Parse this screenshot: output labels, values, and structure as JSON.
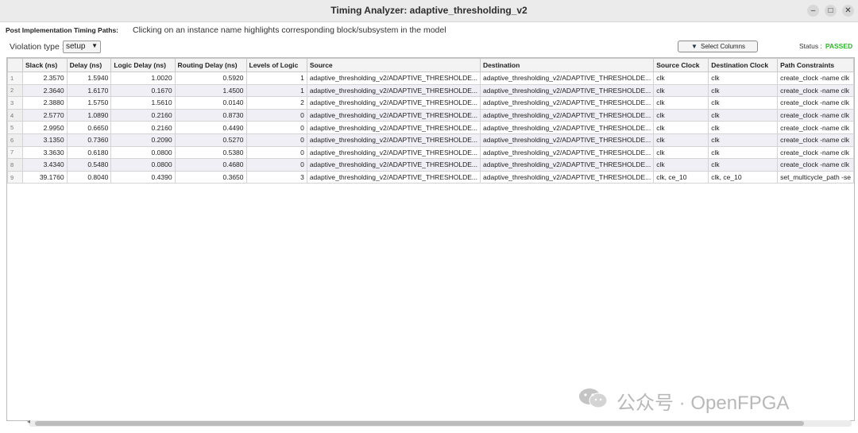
{
  "window": {
    "title": "Timing Analyzer: adaptive_thresholding_v2",
    "minimize": "–",
    "maximize": "□",
    "close": "✕"
  },
  "info": {
    "label": "Post Implementation Timing Paths:",
    "message": "Clicking on an instance name highlights corresponding block/subsystem in the model"
  },
  "toolbar": {
    "violation_label": "Violation type :",
    "violation_value": "setup",
    "select_columns": "Select Columns",
    "status_label": "Status :",
    "status_value": "PASSED",
    "status_color": "#2db52d"
  },
  "table": {
    "headers": [
      "",
      "Slack (ns)",
      "Delay (ns)",
      "Logic Delay (ns)",
      "Routing Delay (ns)",
      "Levels of Logic",
      "Source",
      "Destination",
      "Source Clock",
      "Destination Clock",
      "Path Constraints"
    ],
    "rows": [
      [
        "1",
        "2.3570",
        "1.5940",
        "1.0020",
        "0.5920",
        "1",
        "adaptive_thresholding_v2/ADAPTIVE_THRESHOLDE...",
        "adaptive_thresholding_v2/ADAPTIVE_THRESHOLDE...",
        "clk",
        "clk",
        "create_clock -name clk"
      ],
      [
        "2",
        "2.3640",
        "1.6170",
        "0.1670",
        "1.4500",
        "1",
        "adaptive_thresholding_v2/ADAPTIVE_THRESHOLDE...",
        "adaptive_thresholding_v2/ADAPTIVE_THRESHOLDE...",
        "clk",
        "clk",
        "create_clock -name clk"
      ],
      [
        "3",
        "2.3880",
        "1.5750",
        "1.5610",
        "0.0140",
        "2",
        "adaptive_thresholding_v2/ADAPTIVE_THRESHOLDE...",
        "adaptive_thresholding_v2/ADAPTIVE_THRESHOLDE...",
        "clk",
        "clk",
        "create_clock -name clk"
      ],
      [
        "4",
        "2.5770",
        "1.0890",
        "0.2160",
        "0.8730",
        "0",
        "adaptive_thresholding_v2/ADAPTIVE_THRESHOLDE...",
        "adaptive_thresholding_v2/ADAPTIVE_THRESHOLDE...",
        "clk",
        "clk",
        "create_clock -name clk"
      ],
      [
        "5",
        "2.9950",
        "0.6650",
        "0.2160",
        "0.4490",
        "0",
        "adaptive_thresholding_v2/ADAPTIVE_THRESHOLDE...",
        "adaptive_thresholding_v2/ADAPTIVE_THRESHOLDE...",
        "clk",
        "clk",
        "create_clock -name clk"
      ],
      [
        "6",
        "3.1350",
        "0.7360",
        "0.2090",
        "0.5270",
        "0",
        "adaptive_thresholding_v2/ADAPTIVE_THRESHOLDE...",
        "adaptive_thresholding_v2/ADAPTIVE_THRESHOLDE...",
        "clk",
        "clk",
        "create_clock -name clk"
      ],
      [
        "7",
        "3.3630",
        "0.6180",
        "0.0800",
        "0.5380",
        "0",
        "adaptive_thresholding_v2/ADAPTIVE_THRESHOLDE...",
        "adaptive_thresholding_v2/ADAPTIVE_THRESHOLDE...",
        "clk",
        "clk",
        "create_clock -name clk"
      ],
      [
        "8",
        "3.4340",
        "0.5480",
        "0.0800",
        "0.4680",
        "0",
        "adaptive_thresholding_v2/ADAPTIVE_THRESHOLDE...",
        "adaptive_thresholding_v2/ADAPTIVE_THRESHOLDE...",
        "clk",
        "clk",
        "create_clock -name clk"
      ],
      [
        "9",
        "39.1760",
        "0.8040",
        "0.4390",
        "0.3650",
        "3",
        "adaptive_thresholding_v2/ADAPTIVE_THRESHOLDE...",
        "adaptive_thresholding_v2/ADAPTIVE_THRESHOLDE...",
        "clk, ce_10",
        "clk, ce_10",
        "set_multicycle_path -se"
      ]
    ]
  },
  "watermark": {
    "text": "公众号 · OpenFPGA"
  }
}
